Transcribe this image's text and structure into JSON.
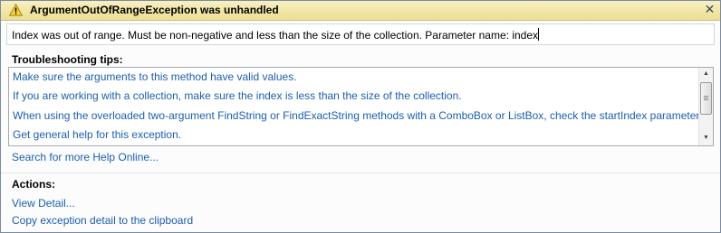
{
  "dialog": {
    "title": "ArgumentOutOfRangeException was unhandled",
    "message": "Index was out of range. Must be non-negative and less than the size of the collection. Parameter name: index"
  },
  "troubleshooting": {
    "header": "Troubleshooting tips:",
    "tips": [
      "Make sure the arguments to this method have valid values.",
      "If you are working with a collection, make sure the index is less than the size of the collection.",
      "When using the overloaded two-argument FindString or FindExactString methods with a ComboBox or ListBox, check the startIndex parameter.",
      "Get general help for this exception."
    ],
    "search_online": "Search for more Help Online..."
  },
  "actions": {
    "header": "Actions:",
    "view_detail": "View Detail...",
    "copy_detail": "Copy exception detail to the clipboard"
  },
  "icons": {
    "title_icon": "warning-icon",
    "close_icon": "close-icon"
  },
  "colors": {
    "link": "#1c5eb0",
    "title_bar": "#f1e6a5"
  }
}
